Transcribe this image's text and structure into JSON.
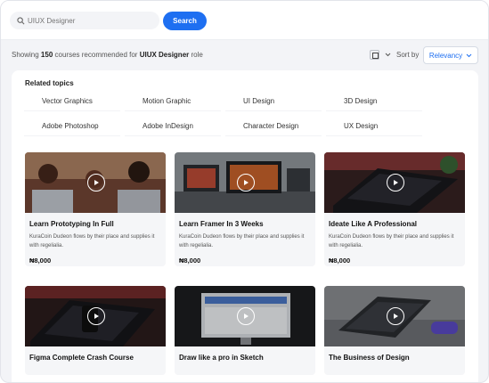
{
  "search": {
    "placeholder": "UIUX Designer",
    "button_label": "Search"
  },
  "results": {
    "prefix": "Showing",
    "count": "150",
    "middle": "courses recommended for",
    "role": "UIUX Designer",
    "suffix": "role"
  },
  "sort": {
    "label": "Sort by",
    "selected": "Relevancy"
  },
  "related": {
    "title": "Related topics",
    "topics": [
      "Vector Graphics",
      "Motion Graphic",
      "UI Design",
      "3D Design",
      "Adobe Photoshop",
      "Adobe InDesign",
      "Character Design",
      "UX Design"
    ]
  },
  "courses": [
    {
      "title": "Learn Prototyping In Full",
      "desc": "KuraCoin Dudeon flows by their place and supplies it with regelialia.",
      "price": "₦8,000"
    },
    {
      "title": "Learn Framer In 3 Weeks",
      "desc": "KuraCoin Dudeon flows by their place and supplies it with regelialia.",
      "price": "₦8,000"
    },
    {
      "title": "Ideate Like A Professional",
      "desc": "KuraCoin Dudeon flows by their place and supplies it with regelialia.",
      "price": "₦8,000"
    },
    {
      "title": "Figma Complete Crash Course",
      "desc": "",
      "price": ""
    },
    {
      "title": "Draw like a pro in Sketch",
      "desc": "",
      "price": ""
    },
    {
      "title": "The Business of Design",
      "desc": "",
      "price": ""
    }
  ],
  "colors": {
    "accent": "#1e6ff1",
    "background": "#f3f4f7",
    "card": "#f5f6f8"
  }
}
